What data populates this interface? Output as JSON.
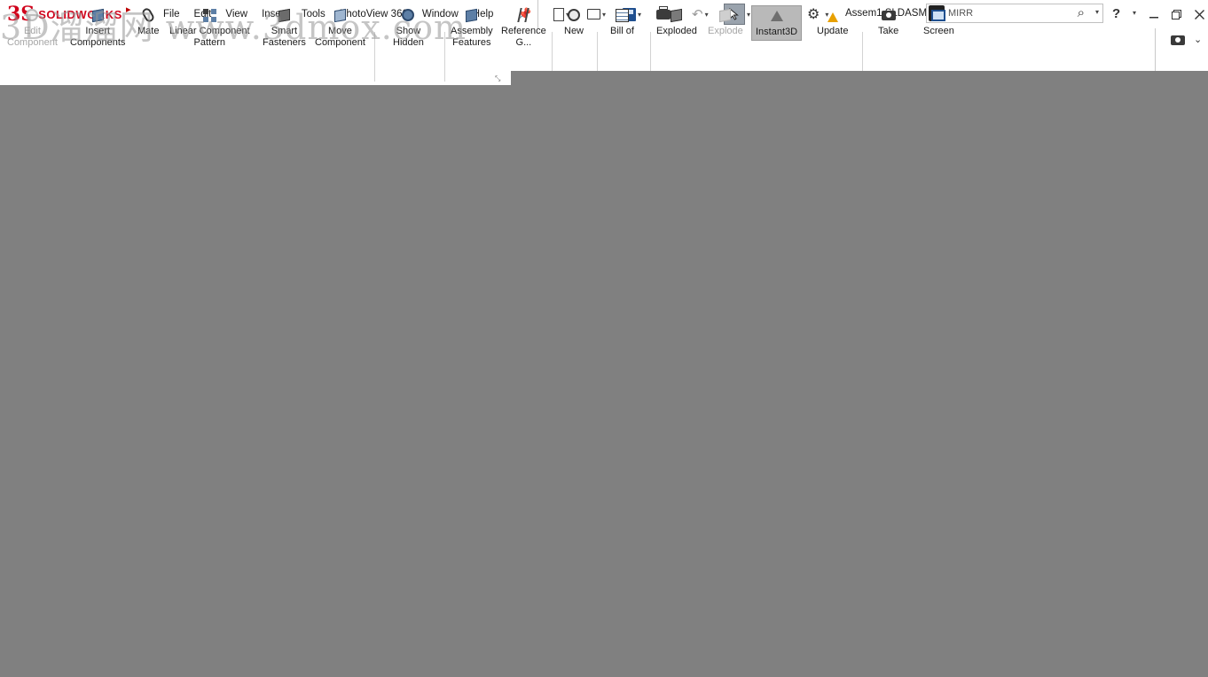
{
  "app": {
    "logo_text": "SOLIDWORKS",
    "logo_mark": "3S",
    "document_title": "Assem1.SLDASM"
  },
  "menu": [
    "File",
    "Edit",
    "View",
    "Insert",
    "Tools",
    "PhotoView 360",
    "Window",
    "Help"
  ],
  "search": {
    "value": "MIRR",
    "cmd_glyph": ">"
  },
  "ribbon": [
    {
      "label_line1": "Edit",
      "label_line2": "Component",
      "icon": "edit-component-icon",
      "disabled": true
    },
    {
      "label_line1": "Insert",
      "label_line2": "Components",
      "icon": "insert-components-icon"
    },
    {
      "label_line1": "Mate",
      "label_line2": "",
      "icon": "mate-icon"
    },
    {
      "label_line1": "Linear Component",
      "label_line2": "Pattern",
      "icon": "linear-pattern-icon"
    },
    {
      "label_line1": "Smart",
      "label_line2": "Fasteners",
      "icon": "smart-fasteners-icon"
    },
    {
      "label_line1": "Move",
      "label_line2": "Component",
      "icon": "move-component-icon"
    },
    {
      "label_line1": "Show",
      "label_line2": "Hidden",
      "icon": "show-hidden-icon"
    },
    {
      "label_line1": "Assembly",
      "label_line2": "Features",
      "icon": "assembly-features-icon"
    },
    {
      "label_line1": "Reference",
      "label_line2": "G...",
      "icon": "reference-geometry-icon"
    },
    {
      "label_line1": "New",
      "label_line2": "",
      "icon": "new-motion-study-icon"
    },
    {
      "label_line1": "Bill of",
      "label_line2": "",
      "icon": "bill-of-materials-icon"
    },
    {
      "label_line1": "Exploded",
      "label_line2": "",
      "icon": "exploded-view-icon"
    },
    {
      "label_line1": "Explode",
      "label_line2": "",
      "icon": "explode-line-icon",
      "disabled": true
    },
    {
      "label_line1": "Instant3D",
      "label_line2": "",
      "icon": "instant3d-icon",
      "active": true
    },
    {
      "label_line1": "Update",
      "label_line2": "",
      "icon": "update-icon"
    },
    {
      "label_line1": "Take",
      "label_line2": "",
      "icon": "take-snapshot-icon"
    },
    {
      "label_line1": "Screen",
      "label_line2": "",
      "icon": "screen-capture-icon"
    }
  ],
  "watermark": "3D溜溜网 www.3dmox.com",
  "colors": {
    "viewport": "#808080",
    "brand_red": "#d0021b",
    "active_tool": "#b9b9b9"
  }
}
